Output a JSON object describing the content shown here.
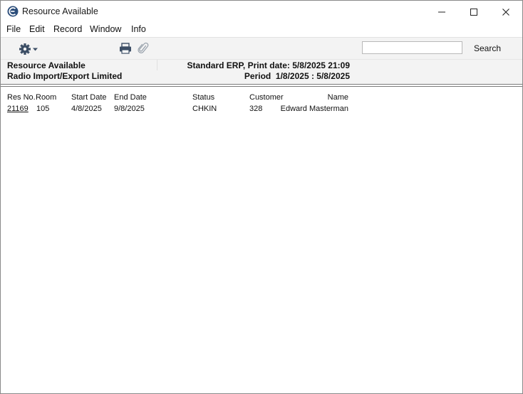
{
  "window": {
    "title": "Resource Available"
  },
  "menu": [
    "File",
    "Edit",
    "Record",
    "Window",
    "Info"
  ],
  "toolbar": {
    "search_value": "",
    "search_label": "Search"
  },
  "report": {
    "name": "Resource Available",
    "company": "Radio Import/Export Limited",
    "print_info": "Standard ERP, Print date: 5/8/2025 21:09",
    "period": "Period  1/8/2025 : 5/8/2025"
  },
  "table": {
    "columns": [
      "Res No.",
      "Room",
      "Start Date",
      "End Date",
      "Status",
      "Customer",
      "Name"
    ],
    "rows": [
      {
        "res_no": "21169",
        "room": "105",
        "start": "4/8/2025",
        "end": "9/8/2025",
        "status": "CHKIN",
        "customer": "328",
        "name": "Edward Masterman"
      }
    ]
  }
}
